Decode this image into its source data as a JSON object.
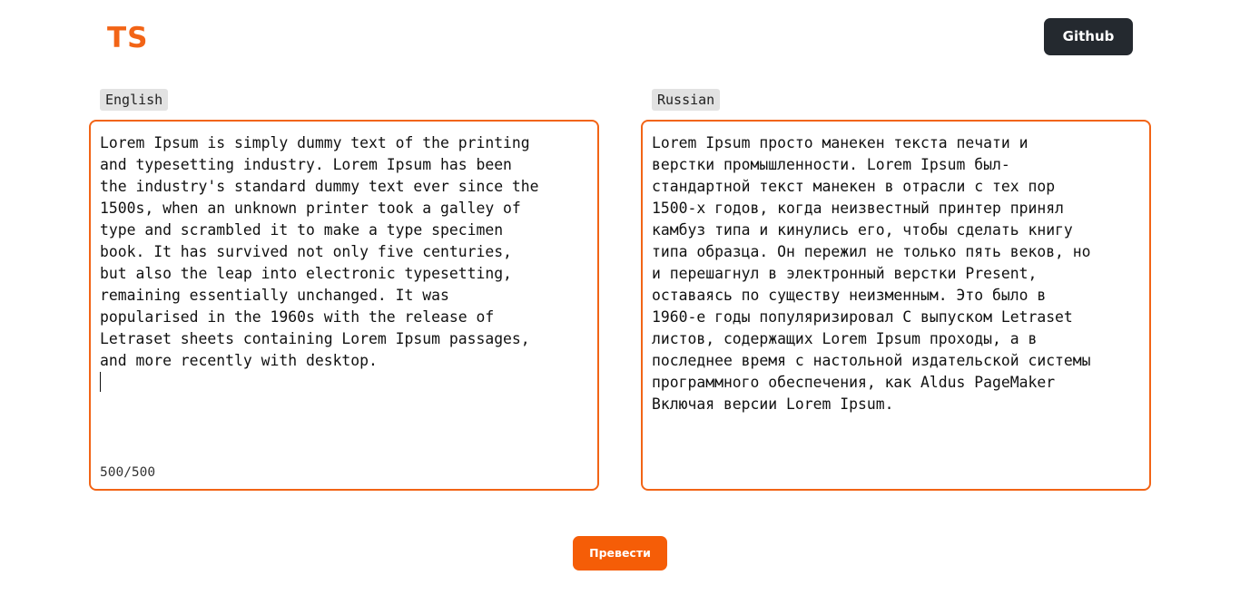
{
  "header": {
    "logo": "TS",
    "github_label": "Github"
  },
  "source": {
    "language": "English",
    "text": "Lorem Ipsum is simply dummy text of the printing\nand typesetting industry. Lorem Ipsum has been\nthe industry's standard dummy text ever since the\n1500s, when an unknown printer took a galley of\ntype and scrambled it to make a type specimen\nbook. It has survived not only five centuries,\nbut also the leap into electronic typesetting,\nremaining essentially unchanged. It was\npopularised in the 1960s with the release of\nLetraset sheets containing Lorem Ipsum passages,\nand more recently with desktop.",
    "char_count": "500/500"
  },
  "target": {
    "language": "Russian",
    "text": "Lorem Ipsum просто манекен текста печати и\nверстки промышленности. Lorem Ipsum был-\nстандартной текст манекен в отрасли с тех пор\n1500-х годов, когда неизвестный принтер принял\nкамбуз типа и кинулись его, чтобы сделать книгу\nтипа образца. Он пережил не только пять веков, но\nи перешагнул в электронный верстки Present,\nоставаясь по существу неизменным. Это было в\n1960-е годы популяризировал С выпуском Letraset\nлистов, содержащих Lorem Ipsum проходы, а в\nпоследнее время с настольной издательской системы\nпрограммного обеспечения, как Aldus PageMaker\nВключая версии Lorem Ipsum."
  },
  "actions": {
    "translate_label": "Превести"
  },
  "colors": {
    "accent": "#f26416",
    "button_primary": "#f55d07",
    "button_dark": "#24292f",
    "label_bg": "#e2e2e2"
  }
}
